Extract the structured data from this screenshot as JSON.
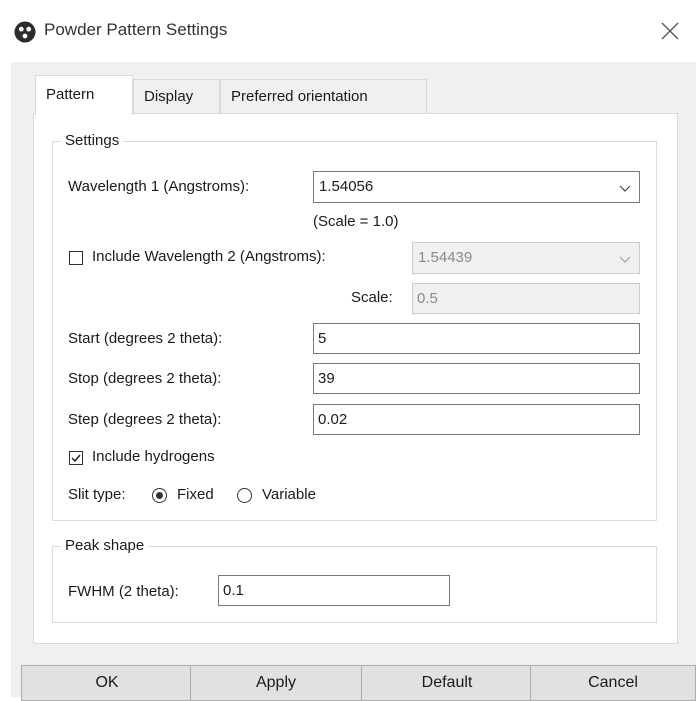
{
  "window": {
    "title": "Powder Pattern Settings",
    "icon": "app-icon",
    "close_icon": "close-icon"
  },
  "tabs": [
    {
      "label": "Pattern",
      "active": true
    },
    {
      "label": "Display",
      "active": false
    },
    {
      "label": "Preferred orientation",
      "active": false
    }
  ],
  "settings": {
    "group_title": "Settings",
    "wavelength1_label": "Wavelength 1 (Angstroms):",
    "wavelength1_value": "1.54056",
    "scale_note": "(Scale = 1.0)",
    "wavelength2_checkbox_label": "Include Wavelength 2 (Angstroms):",
    "wavelength2_checked": false,
    "wavelength2_value": "1.54439",
    "scale_label": "Scale:",
    "scale_value": "0.5",
    "start_label": "Start (degrees 2 theta):",
    "start_value": "5",
    "stop_label": "Stop (degrees 2 theta):",
    "stop_value": "39",
    "step_label": "Step (degrees 2 theta):",
    "step_value": "0.02",
    "hydrogens_label": "Include hydrogens",
    "hydrogens_checked": true,
    "slit_label": "Slit type:",
    "slit_options": [
      {
        "label": "Fixed",
        "selected": true
      },
      {
        "label": "Variable",
        "selected": false
      }
    ]
  },
  "peak_shape": {
    "group_title": "Peak shape",
    "fwhm_label": "FWHM (2 theta):",
    "fwhm_value": "0.1"
  },
  "buttons": {
    "ok": "OK",
    "apply": "Apply",
    "default": "Default",
    "cancel": "Cancel"
  }
}
